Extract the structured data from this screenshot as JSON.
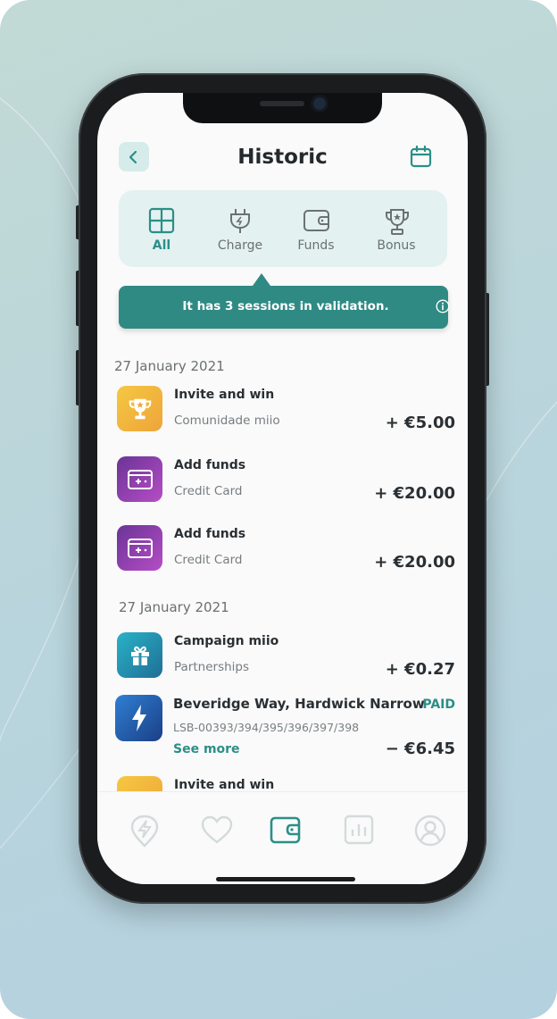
{
  "header": {
    "title": "Historic"
  },
  "tabs": [
    {
      "label": "All",
      "icon": "grid-icon",
      "active": true
    },
    {
      "label": "Charge",
      "icon": "plug-icon",
      "active": false
    },
    {
      "label": "Funds",
      "icon": "wallet-icon",
      "active": false
    },
    {
      "label": "Bonus",
      "icon": "trophy-icon",
      "active": false
    }
  ],
  "banner": {
    "text": "It has 3 sessions in validation."
  },
  "groups": [
    {
      "date": "27 January 2021",
      "items": [
        {
          "title": "Invite and win",
          "subtitle": "Comunidade miio",
          "amount": "+ €5.00",
          "icon": "trophy-icon"
        },
        {
          "title": "Add funds",
          "subtitle": "Credit Card",
          "amount": "+ €20.00",
          "icon": "wallet-add-icon"
        },
        {
          "title": "Add funds",
          "subtitle": "Credit Card",
          "amount": "+ €20.00",
          "icon": "wallet-add-icon"
        }
      ]
    },
    {
      "date": "27 January 2021",
      "items": [
        {
          "title": "Campaign miio",
          "subtitle": "Partnerships",
          "amount": "+ €0.27",
          "icon": "gift-icon"
        }
      ],
      "charge": {
        "title": "Beveridge Way, Hardwick Narrow",
        "status": "PAID",
        "sessions": "LSB-00393/394/395/396/397/398",
        "link": "See more",
        "amount": "− €6.45",
        "icon": "lightning-icon"
      },
      "next": {
        "title": "Invite and win",
        "icon": "trophy-icon"
      }
    }
  ],
  "nav": [
    "bolt-pin-icon",
    "heart-icon",
    "wallet-icon",
    "chart-icon",
    "profile-icon"
  ],
  "colors": {
    "accent": "#2b8f87",
    "banner": "#2f8a84",
    "tabs_bg": "#e3f1f0"
  }
}
